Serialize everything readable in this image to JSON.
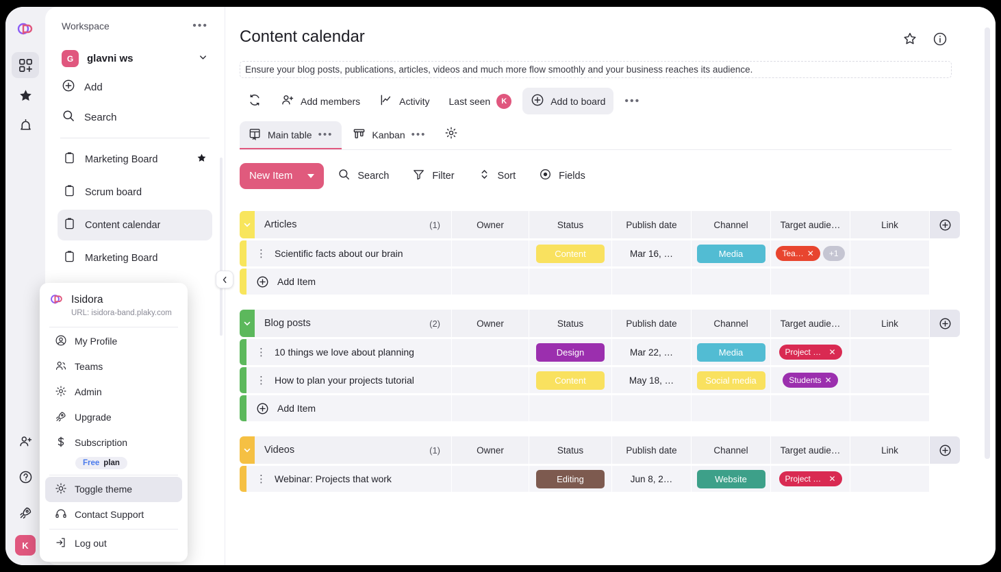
{
  "rail": {
    "logo": "plaky-logo-icon",
    "items": [
      {
        "name": "boards-add-icon",
        "active": true
      },
      {
        "name": "favorites-star-icon",
        "active": false
      },
      {
        "name": "notifications-bell-icon",
        "active": false
      }
    ],
    "bottom": [
      {
        "name": "invite-user-icon"
      },
      {
        "name": "help-circle-icon"
      },
      {
        "name": "rocket-upgrade-icon"
      }
    ],
    "avatar_initial": "K"
  },
  "sidebar": {
    "header_label": "Workspace",
    "more_label": "•••",
    "workspace": {
      "initial": "G",
      "name": "glavni ws"
    },
    "actions": [
      {
        "label": "Add",
        "icon": "plus-circle-icon"
      },
      {
        "label": "Search",
        "icon": "search-icon"
      }
    ],
    "boards": [
      {
        "label": "Marketing Board",
        "starred": true,
        "active": false
      },
      {
        "label": "Scrum board",
        "starred": false,
        "active": false
      },
      {
        "label": "Content calendar",
        "starred": false,
        "active": true
      },
      {
        "label": "Marketing Board",
        "starred": false,
        "active": false
      }
    ]
  },
  "user_menu": {
    "name": "Isidora",
    "url": "URL: isidora-band.plaky.com",
    "items": [
      {
        "label": "My Profile",
        "icon": "user-circle-icon",
        "highlight": false
      },
      {
        "label": "Teams",
        "icon": "teams-icon",
        "highlight": false
      },
      {
        "label": "Admin",
        "icon": "gear-icon",
        "highlight": false
      },
      {
        "label": "Upgrade",
        "icon": "rocket-icon",
        "highlight": false
      },
      {
        "label": "Subscription",
        "icon": "dollar-icon",
        "highlight": false
      }
    ],
    "plan_badge": {
      "free": "Free",
      "plan": "plan"
    },
    "items2": [
      {
        "label": "Toggle theme",
        "icon": "sun-icon",
        "highlight": true
      },
      {
        "label": "Contact Support",
        "icon": "headset-icon",
        "highlight": false
      }
    ],
    "items3": [
      {
        "label": "Log out",
        "icon": "logout-icon",
        "highlight": false
      }
    ]
  },
  "board": {
    "title": "Content calendar",
    "description": "Ensure your blog posts, publications, articles, videos and much more flow smoothly and your business reaches its audience.",
    "title_actions": [
      {
        "name": "favorite-star-icon"
      },
      {
        "name": "info-circle-icon"
      }
    ],
    "meta": [
      {
        "label": "",
        "icon": "activity-refresh-icon"
      },
      {
        "label": "Add members",
        "icon": "add-member-icon"
      },
      {
        "label": "Activity",
        "icon": "activity-chart-icon"
      },
      {
        "label": "Last seen",
        "icon": "avatar",
        "avatar": "K"
      },
      {
        "label": "Add to board",
        "icon": "plus-circle-icon",
        "filled": true
      },
      {
        "label": "•••",
        "icon": "more-icon"
      }
    ],
    "tabs": [
      {
        "label": "Main table",
        "icon": "table-home-icon",
        "active": true,
        "more": "•••"
      },
      {
        "label": "Kanban",
        "icon": "kanban-icon",
        "active": false,
        "more": "•••"
      }
    ],
    "tab_settings_icon": "gear-icon",
    "toolbar": {
      "new_item": "New Item",
      "buttons": [
        {
          "label": "Search",
          "icon": "search-icon"
        },
        {
          "label": "Filter",
          "icon": "filter-icon"
        },
        {
          "label": "Sort",
          "icon": "sort-icon"
        },
        {
          "label": "Fields",
          "icon": "eye-icon"
        }
      ]
    },
    "columns": [
      "Owner",
      "Status",
      "Publish date",
      "Channel",
      "Target audie…",
      "Link"
    ],
    "add_item_label": "Add Item",
    "groups": [
      {
        "name": "Articles",
        "count": "(1)",
        "color": "#f8e55c",
        "rows": [
          {
            "name": "Scientific facts about our brain",
            "owner": "",
            "status": {
              "label": "Content",
              "color": "#f9e15f"
            },
            "date": "Mar 16, …",
            "channel": {
              "label": "Media",
              "color": "#52bcd3"
            },
            "tags": [
              {
                "label": "Tea…",
                "color": "#e8452f"
              }
            ],
            "more_tags": "+1",
            "link": ""
          }
        ]
      },
      {
        "name": "Blog posts",
        "count": "(2)",
        "color": "#5cb85c",
        "rows": [
          {
            "name": "10 things we love about planning",
            "owner": "",
            "status": {
              "label": "Design",
              "color": "#9b2fae"
            },
            "date": "Mar 22, …",
            "channel": {
              "label": "Media",
              "color": "#52bcd3"
            },
            "tags": [
              {
                "label": "Project pla…",
                "color": "#d92a52"
              }
            ],
            "more_tags": "",
            "link": ""
          },
          {
            "name": "How to plan your projects tutorial",
            "owner": "",
            "status": {
              "label": "Content",
              "color": "#f9e15f"
            },
            "date": "May 18, …",
            "channel": {
              "label": "Social media",
              "color": "#f9e15f"
            },
            "tags": [
              {
                "label": "Students",
                "color": "#9b2fae"
              }
            ],
            "more_tags": "",
            "link": ""
          }
        ]
      },
      {
        "name": "Videos",
        "count": "(1)",
        "color": "#f5c043",
        "rows": [
          {
            "name": "Webinar: Projects that work",
            "owner": "",
            "status": {
              "label": "Editing",
              "color": "#7d5a4f"
            },
            "date": "Jun 8, 2…",
            "channel": {
              "label": "Website",
              "color": "#3da089"
            },
            "tags": [
              {
                "label": "Project pla…",
                "color": "#d92a52"
              }
            ],
            "more_tags": "",
            "link": ""
          }
        ]
      }
    ]
  },
  "colors": {
    "brand_pink": "#e05a7d",
    "surface": "#f1f1f5",
    "row": "#f4f4f8"
  }
}
